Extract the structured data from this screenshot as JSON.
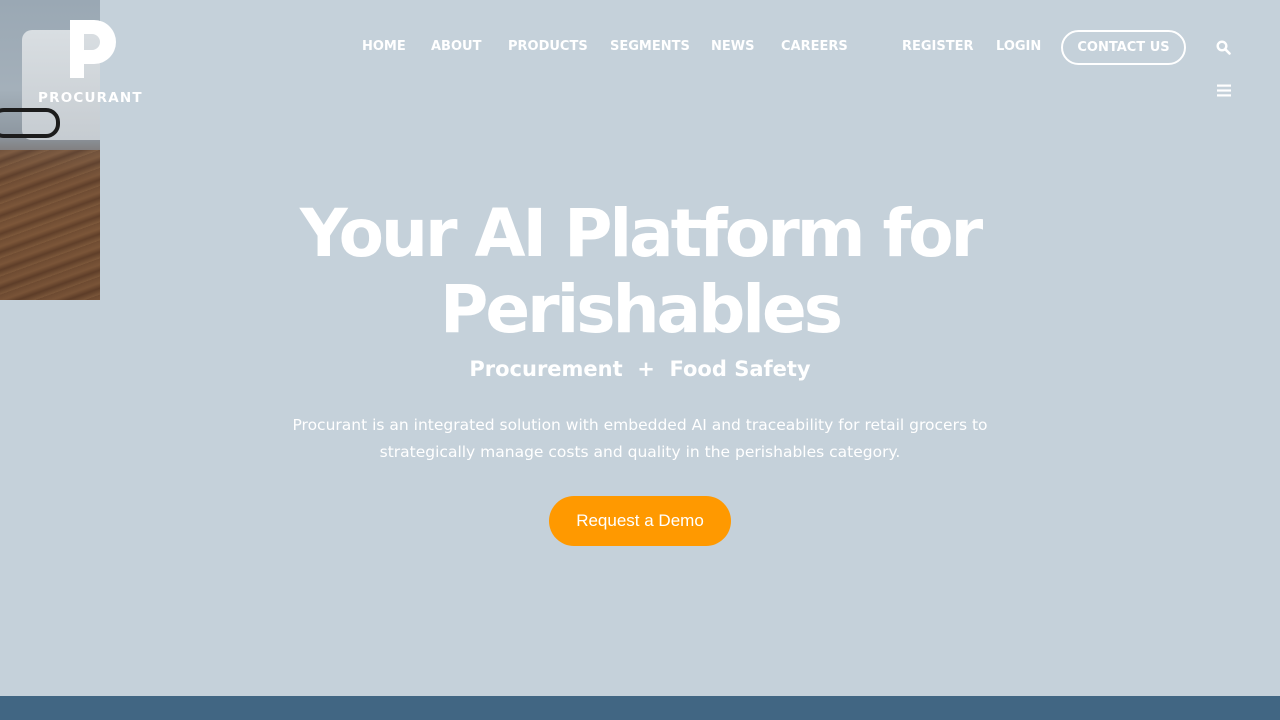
{
  "brand": {
    "name": "PROCURANT"
  },
  "nav": {
    "items": [
      {
        "label": "HOME"
      },
      {
        "label": "ABOUT"
      },
      {
        "label": "PRODUCTS"
      },
      {
        "label": "SEGMENTS"
      },
      {
        "label": "NEWS"
      },
      {
        "label": "CAREERS"
      },
      {
        "label": "REGISTER"
      },
      {
        "label": "LOGIN"
      }
    ],
    "contact_label": "CONTACT US",
    "search_icon": "search-icon",
    "menu_icon": "hamburger-menu-icon"
  },
  "hero": {
    "title_line1": "Your AI Platform for",
    "title_line2": "Perishables",
    "subtitle": "Procurement  +  Food Safety",
    "description": "Procurant is an integrated solution with embedded AI and traceability for retail grocers to strategically manage costs and quality in the perishables category.",
    "cta_label": "Request a Demo"
  },
  "colors": {
    "background": "#c5d1da",
    "accent": "#ff9900",
    "footer_bar": "#416683",
    "text": "#ffffff"
  }
}
